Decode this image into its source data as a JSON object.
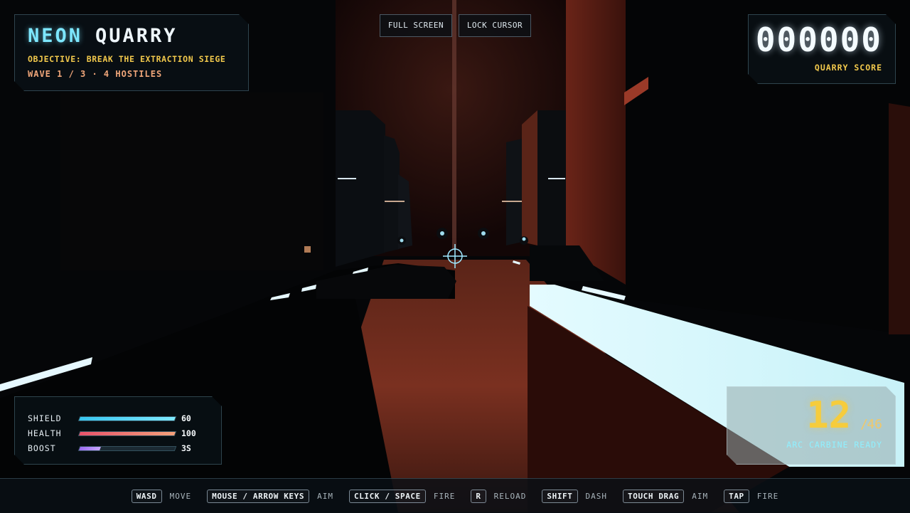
{
  "hud": {
    "title_part1": "NEON",
    "title_part2": "QUARRY",
    "objective": "OBJECTIVE: BREAK THE EXTRACTION SIEGE",
    "wave": "WAVE 1 / 3 · 4 HOSTILES"
  },
  "top_buttons": {
    "full_screen": "FULL SCREEN",
    "lock_cursor": "LOCK CURSOR"
  },
  "score": {
    "value": "000000",
    "label": "QUARRY SCORE"
  },
  "stats": [
    {
      "label": "SHIELD",
      "value": "60",
      "fill": 1.0,
      "color_from": "#38c6f0",
      "color_to": "#7ee9ff"
    },
    {
      "label": "HEALTH",
      "value": "100",
      "fill": 1.0,
      "color_from": "#e8536b",
      "color_to": "#f4a07a"
    },
    {
      "label": "BOOST",
      "value": "3S",
      "fill": 0.22,
      "color_from": "#9b6cf0",
      "color_to": "#c7a6ff"
    }
  ],
  "ammo": {
    "current": "12",
    "separator": "/",
    "total": "46",
    "status": "ARC CARBINE READY"
  },
  "controls": [
    {
      "key": "WASD",
      "action": "MOVE"
    },
    {
      "key": "MOUSE / ARROW KEYS",
      "action": "AIM"
    },
    {
      "key": "CLICK / SPACE",
      "action": "FIRE"
    },
    {
      "key": "R",
      "action": "RELOAD"
    },
    {
      "key": "SHIFT",
      "action": "DASH"
    },
    {
      "key": "TOUCH DRAG",
      "action": "AIM"
    },
    {
      "key": "TAP",
      "action": "FIRE"
    }
  ],
  "colors": {
    "accent_cyan": "#7de7ff",
    "accent_yellow": "#f2c94c",
    "accent_orange": "#f0a67a",
    "floor_red": "#8a3322"
  },
  "icons": {
    "crosshair": "crosshair-icon"
  }
}
